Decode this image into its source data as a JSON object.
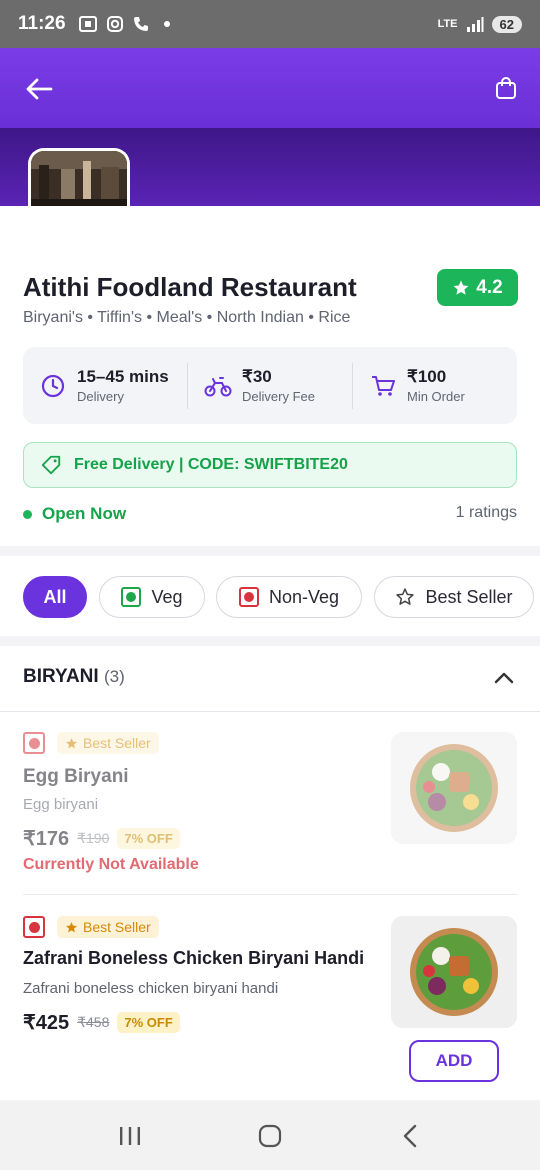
{
  "status_bar": {
    "time": "11:26",
    "network": "LTE",
    "battery": "62"
  },
  "restaurant": {
    "name": "Atithi Foodland Restaurant",
    "rating": "4.2",
    "cuisines": "Biryani's • Tiffin's • Meal's • North Indian • Rice"
  },
  "info": {
    "delivery_time": {
      "value": "15–45 mins",
      "label": "Delivery",
      "icon": "clock-icon"
    },
    "delivery_fee": {
      "value": "₹30",
      "label": "Delivery Fee",
      "icon": "bike-icon"
    },
    "min_order": {
      "value": "₹100",
      "label": "Min Order",
      "icon": "cart-icon"
    }
  },
  "promo": {
    "text": "Free Delivery | CODE: SWIFTBITE20",
    "icon": "tag-icon"
  },
  "open_status": "Open Now",
  "ratings_count": "1 ratings",
  "filters": [
    {
      "label": "All",
      "active": true
    },
    {
      "label": "Veg",
      "active": false
    },
    {
      "label": "Non-Veg",
      "active": false
    },
    {
      "label": "Best Seller",
      "active": false
    }
  ],
  "section": {
    "title": "BIRYANI",
    "count": "(3)"
  },
  "items": [
    {
      "badge": "Best Seller",
      "name": "Egg Biryani",
      "description": "Egg biryani",
      "price": "₹176",
      "old_price": "₹190",
      "discount": "7% OFF",
      "availability": "Currently Not Available"
    },
    {
      "badge": "Best Seller",
      "name": "Zafrani Boneless Chicken Biryani Handi",
      "description": "Zafrani boneless chicken biryani handi",
      "price": "₹425",
      "old_price": "₹458",
      "discount": "7% OFF",
      "add_label": "ADD"
    }
  ],
  "colors": {
    "brand": "#6b33dd",
    "rating": "#1cb55a",
    "nonveg": "#d8343e",
    "veg": "#1ea64b"
  }
}
